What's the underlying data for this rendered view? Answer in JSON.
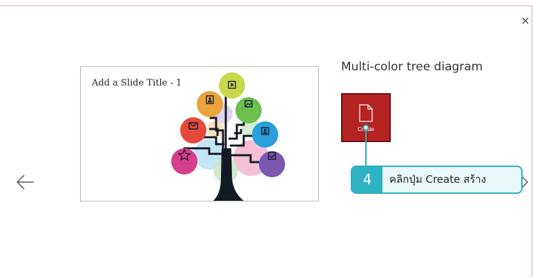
{
  "dialog": {
    "close_glyph": "×",
    "prev_label": "previous template",
    "next_label": "next template"
  },
  "preview": {
    "slide_title": "Add a Slide Title - 1"
  },
  "template": {
    "title": "Multi-color tree diagram",
    "create_label": "Create",
    "create_bg": "#b52222"
  },
  "callout": {
    "step": "4",
    "text": "คลิกปุ่ม Create สร้าง",
    "accent": "#2fb3c2"
  },
  "icons": {
    "close": "close-icon",
    "prev": "arrow-left-icon",
    "next": "chevron-right-icon",
    "document": "document-icon",
    "play": "play-icon",
    "person": "person-icon",
    "picture": "picture-icon",
    "mail": "mail-icon",
    "star": "star-icon",
    "checkbox": "checkbox-icon"
  }
}
